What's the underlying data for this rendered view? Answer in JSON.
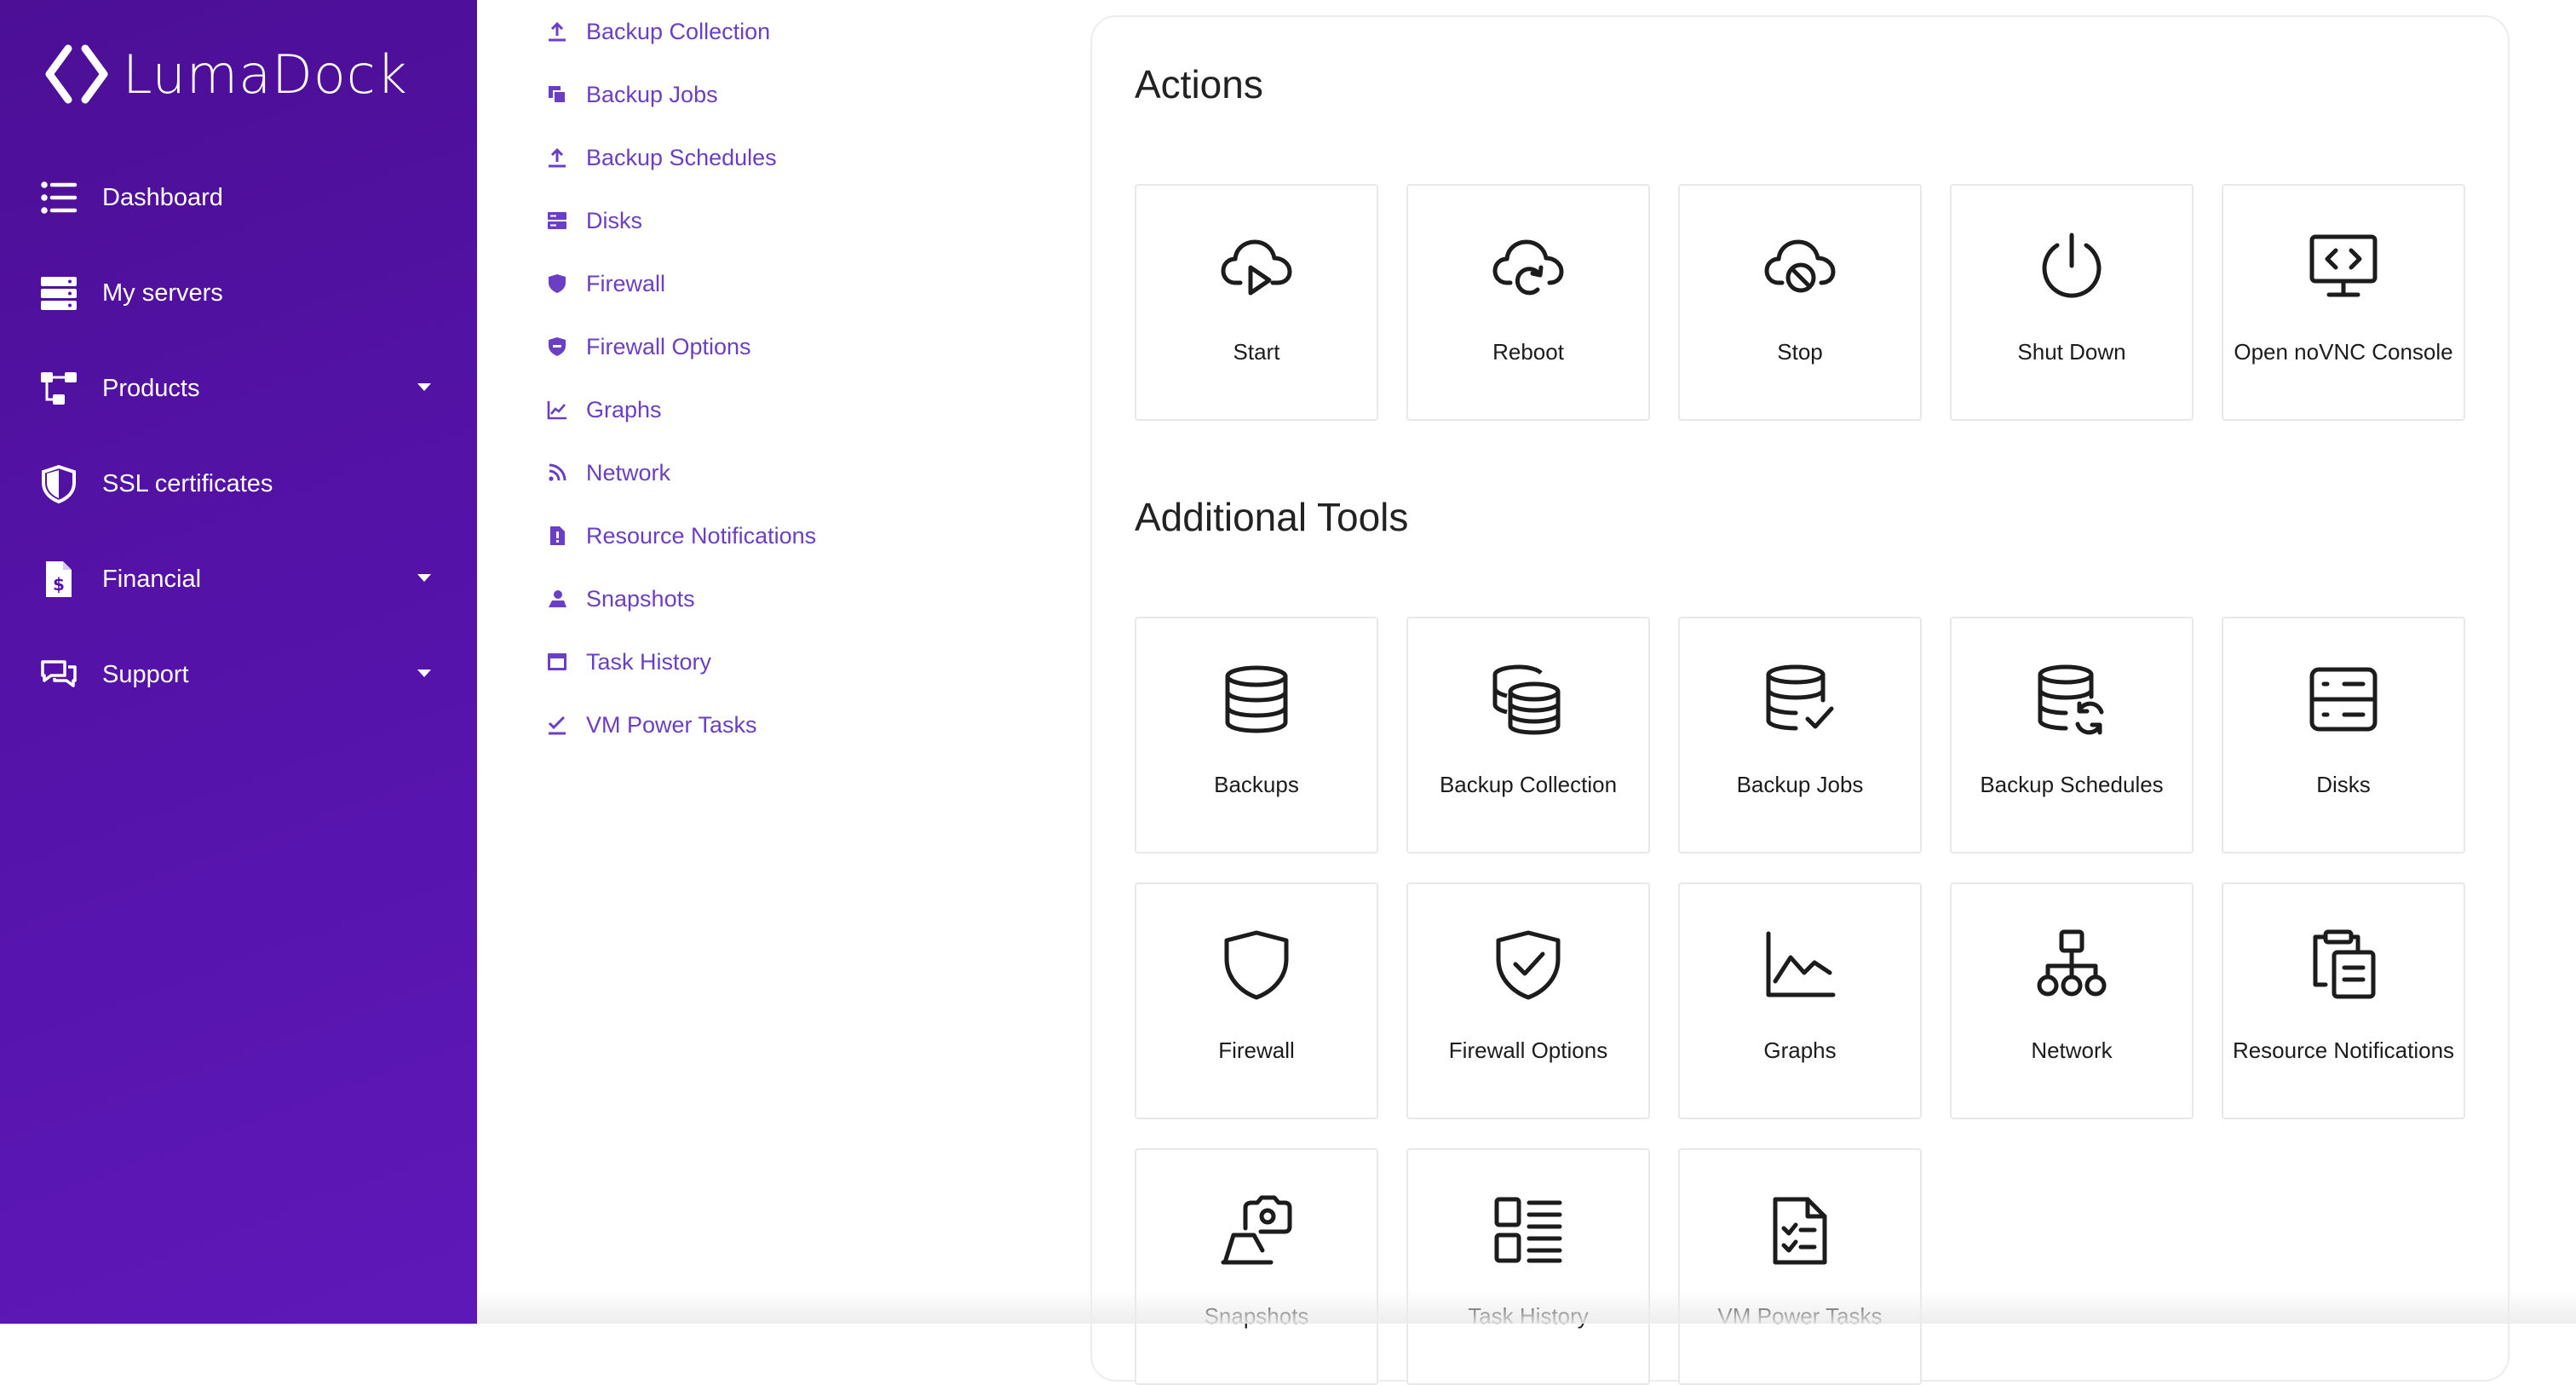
{
  "brand": {
    "name": "LumaDock"
  },
  "sidebar": {
    "items": [
      {
        "label": "Dashboard",
        "icon": "list-icon"
      },
      {
        "label": "My servers",
        "icon": "server-icon"
      },
      {
        "label": "Products",
        "icon": "products-icon",
        "has_dropdown": true
      },
      {
        "label": "SSL certificates",
        "icon": "shield-icon"
      },
      {
        "label": "Financial",
        "icon": "invoice-icon",
        "has_dropdown": true
      },
      {
        "label": "Support",
        "icon": "chat-icon",
        "has_dropdown": true
      }
    ]
  },
  "sublist": {
    "items": [
      {
        "label": "Backup Collection",
        "icon": "upload-icon"
      },
      {
        "label": "Backup Jobs",
        "icon": "copy-icon"
      },
      {
        "label": "Backup Schedules",
        "icon": "upload-icon"
      },
      {
        "label": "Disks",
        "icon": "disk-icon"
      },
      {
        "label": "Firewall",
        "icon": "shield-icon"
      },
      {
        "label": "Firewall Options",
        "icon": "shield-minus-icon"
      },
      {
        "label": "Graphs",
        "icon": "chart-icon"
      },
      {
        "label": "Network",
        "icon": "rss-icon"
      },
      {
        "label": "Resource Notifications",
        "icon": "file-alert-icon"
      },
      {
        "label": "Snapshots",
        "icon": "snapshot-icon"
      },
      {
        "label": "Task History",
        "icon": "window-icon"
      },
      {
        "label": "VM Power Tasks",
        "icon": "check-icon"
      }
    ]
  },
  "actions": {
    "title": "Actions",
    "tiles": [
      {
        "label": "Start",
        "icon": "cloud-play-icon"
      },
      {
        "label": "Reboot",
        "icon": "cloud-refresh-icon"
      },
      {
        "label": "Stop",
        "icon": "cloud-off-icon"
      },
      {
        "label": "Shut Down",
        "icon": "power-icon"
      },
      {
        "label": "Open noVNC Console",
        "icon": "console-icon"
      }
    ]
  },
  "tools": {
    "title": "Additional Tools",
    "tiles": [
      {
        "label": "Backups",
        "icon": "database-icon"
      },
      {
        "label": "Backup Collection",
        "icon": "database-stack-icon"
      },
      {
        "label": "Backup Jobs",
        "icon": "database-check-icon"
      },
      {
        "label": "Backup Schedules",
        "icon": "database-sync-icon"
      },
      {
        "label": "Disks",
        "icon": "disks-icon"
      },
      {
        "label": "Firewall",
        "icon": "shield-icon"
      },
      {
        "label": "Firewall Options",
        "icon": "shield-check-icon"
      },
      {
        "label": "Graphs",
        "icon": "line-chart-icon"
      },
      {
        "label": "Network",
        "icon": "network-icon"
      },
      {
        "label": "Resource Notifications",
        "icon": "clipboard-list-icon"
      },
      {
        "label": "Snapshots",
        "icon": "snapshot-icon"
      },
      {
        "label": "Task History",
        "icon": "task-list-icon"
      },
      {
        "label": "VM Power Tasks",
        "icon": "file-checklist-icon"
      }
    ]
  },
  "colors": {
    "sidebar_bg": "#5613ab",
    "link": "#6b3fc4",
    "tile_border": "#e8e8e8"
  }
}
